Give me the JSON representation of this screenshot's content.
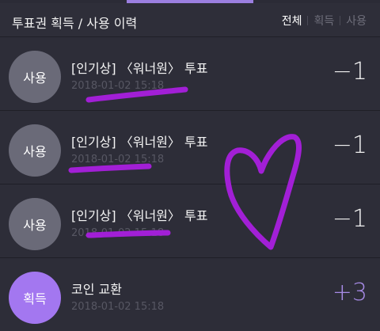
{
  "header": {
    "title": "투표권 획득 / 사용 이력",
    "filters": [
      "전체",
      "획득",
      "사용"
    ]
  },
  "rows": [
    {
      "badge": "사용",
      "title": "[인기상] 〈워너원〉 투표",
      "date": "2018-01-02 15:18",
      "amount": "−1"
    },
    {
      "badge": "사용",
      "title": "[인기상] 〈워너원〉 투표",
      "date": "2018-01-02 15:18",
      "amount": "−1"
    },
    {
      "badge": "사용",
      "title": "[인기상] 〈워너원〉 투표",
      "date": "2018-01-02 15:18",
      "amount": "−1"
    },
    {
      "badge": "획득",
      "title": "코인 교환",
      "date": "2018-01-02 15:18",
      "amount": "+3"
    }
  ],
  "colors": {
    "background": "#2b2b36",
    "accent": "#a377f0",
    "used_badge": "#6a6a78",
    "marker": "#a21fd6"
  }
}
